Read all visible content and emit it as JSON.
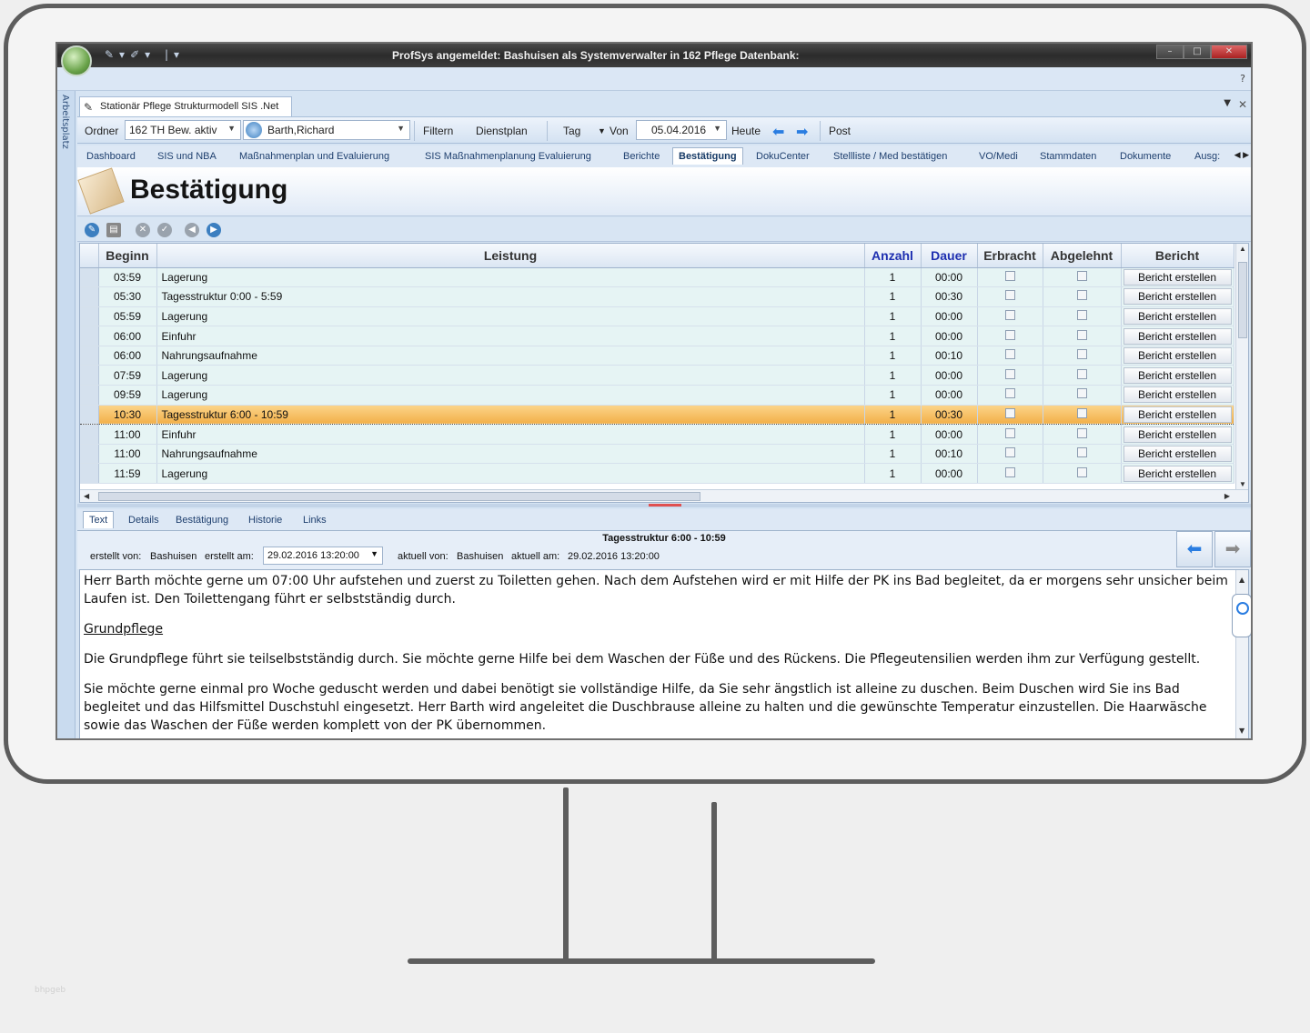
{
  "window": {
    "title": "ProfSys angemeldet: Bashuisen als Systemverwalter in 162 Pflege Datenbank:",
    "help": "?",
    "side_label": "Arbeitsplatz"
  },
  "document_tab": {
    "label": "Stationär Pflege Strukturmodell SIS .Net"
  },
  "toolbar": {
    "ordner_label": "Ordner",
    "ordner_value": "162 TH Bew. aktiv",
    "resident_value": "Barth,Richard",
    "filter_label": "Filtern",
    "dienstplan_label": "Dienstplan",
    "tag_label": "Tag",
    "von_label": "Von",
    "date_value": "05.04.2016",
    "heute_label": "Heute",
    "post_label": "Post"
  },
  "nav_tabs": [
    "Dashboard",
    "SIS und NBA",
    "Maßnahmenplan und Evaluierung",
    "SIS Maßnahmenplanung Evaluierung",
    "Berichte",
    "Bestätigung",
    "DokuCenter",
    "Stellliste / Med bestätigen",
    "VO/Medi",
    "Stammdaten",
    "Dokumente",
    "Ausg:"
  ],
  "page": {
    "title": "Bestätigung"
  },
  "grid": {
    "columns": [
      "Beginn",
      "Leistung",
      "Anzahl",
      "Dauer",
      "Erbracht",
      "Abgelehnt",
      "Bericht"
    ],
    "button_label": "Bericht erstellen",
    "selected_index": 7,
    "rows": [
      {
        "beginn": "03:59",
        "leistung": "Lagerung",
        "anzahl": "1",
        "dauer": "00:00"
      },
      {
        "beginn": "05:30",
        "leistung": "Tagesstruktur 0:00 - 5:59",
        "anzahl": "1",
        "dauer": "00:30"
      },
      {
        "beginn": "05:59",
        "leistung": "Lagerung",
        "anzahl": "1",
        "dauer": "00:00"
      },
      {
        "beginn": "06:00",
        "leistung": "Einfuhr",
        "anzahl": "1",
        "dauer": "00:00"
      },
      {
        "beginn": "06:00",
        "leistung": "Nahrungsaufnahme",
        "anzahl": "1",
        "dauer": "00:10"
      },
      {
        "beginn": "07:59",
        "leistung": "Lagerung",
        "anzahl": "1",
        "dauer": "00:00"
      },
      {
        "beginn": "09:59",
        "leistung": "Lagerung",
        "anzahl": "1",
        "dauer": "00:00"
      },
      {
        "beginn": "10:30",
        "leistung": "Tagesstruktur 6:00 - 10:59",
        "anzahl": "1",
        "dauer": "00:30"
      },
      {
        "beginn": "11:00",
        "leistung": "Einfuhr",
        "anzahl": "1",
        "dauer": "00:00"
      },
      {
        "beginn": "11:00",
        "leistung": "Nahrungsaufnahme",
        "anzahl": "1",
        "dauer": "00:10"
      },
      {
        "beginn": "11:59",
        "leistung": "Lagerung",
        "anzahl": "1",
        "dauer": "00:00"
      }
    ]
  },
  "detail_tabs": [
    "Text",
    "Details",
    "Bestätigung",
    "Historie",
    "Links"
  ],
  "detail": {
    "title": "Tagesstruktur 6:00 - 10:59",
    "created_by_label": "erstellt von:",
    "created_by": "Bashuisen",
    "created_at_label": "erstellt am:",
    "created_at": "29.02.2016 13:20:00",
    "updated_by_label": "aktuell von:",
    "updated_by": "Bashuisen",
    "updated_at_label": "aktuell am:",
    "updated_at": "29.02.2016 13:20:00"
  },
  "text": {
    "p1": "Herr Barth möchte gerne um 07:00 Uhr aufstehen und zuerst zu Toiletten gehen. Nach dem Aufstehen wird er mit Hilfe der PK ins Bad begleitet, da er morgens sehr unsicher beim Laufen ist. Den Toilettengang führt er selbstständig durch.",
    "heading": "Grundpflege",
    "p2": "Die Grundpflege führt sie teilselbstständig durch. Sie möchte gerne Hilfe bei dem Waschen der Füße und des Rückens. Die Pflegeutensilien werden ihm zur Verfügung gestellt.",
    "p3": "Sie möchte gerne einmal pro Woche geduscht werden und dabei benötigt sie vollständige Hilfe, da Sie sehr ängstlich ist alleine zu duschen. Beim Duschen wird Sie ins Bad begleitet und das Hilfsmittel Duschstuhl eingesetzt. Herr Barth wird angeleitet die Duschbrause alleine zu halten und die gewünschte Temperatur einzustellen. Die Haarwäsche sowie das Waschen der Füße werden komplett von der PK übernommen."
  },
  "colors": {
    "selected_row": "#f2b04a",
    "row_bg": "#e6f4f4",
    "header_blue": "#1e2fb0",
    "frame": "#5d5d5d"
  },
  "icons": [
    "app-orb-icon",
    "edit-icon",
    "refresh-icon",
    "print-icon",
    "cancel-icon",
    "confirm-icon",
    "back-icon",
    "forward-icon",
    "arrow-left-icon",
    "arrow-right-icon"
  ],
  "watermark": "bhpgeb"
}
